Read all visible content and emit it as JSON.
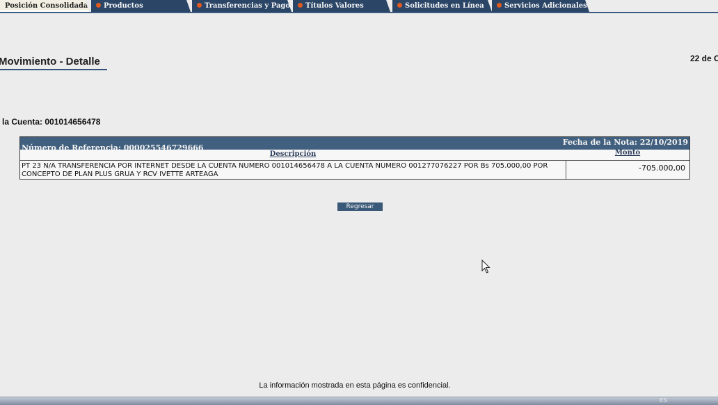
{
  "nav": {
    "tabs": [
      {
        "label": "Posición Consolidada",
        "active": true
      },
      {
        "label": "Productos",
        "active": false
      },
      {
        "label": "Transferencias y Pagos",
        "active": false
      },
      {
        "label": "Títulos Valores",
        "active": false
      },
      {
        "label": "Solicitudes en Línea",
        "active": false
      },
      {
        "label": "Servicios Adicionales",
        "active": false
      }
    ]
  },
  "page": {
    "title": "Movimiento - Detalle",
    "date": "22 de O",
    "account_label": "la Cuenta: 001014656478"
  },
  "detail": {
    "reference": "Número de Referencia: 000025546729666",
    "note_date": "Fecha de la Nota: 22/10/2019",
    "col_description": "Descripción",
    "col_amount": "Monto",
    "description": "PT 23 N/A TRANSFERENCIA POR INTERNET DESDE LA CUENTA NUMERO 001014656478 A LA CUENTA NUMERO 001277076227 POR Bs 705.000,00 POR CONCEPTO DE PLAN PLUS GRUA Y RCV IVETTE ARTEAGA",
    "amount": "-705.000,00"
  },
  "actions": {
    "back_label": "Regresar"
  },
  "footer": {
    "notice": "La información mostrada en esta página es confidencial."
  },
  "taskbar": {
    "lang": "ES"
  },
  "colors": {
    "nav_dark": "#2a4566",
    "header_bar": "#41607f",
    "accent_dot": "#e05a1e",
    "button": "#3a5878"
  }
}
